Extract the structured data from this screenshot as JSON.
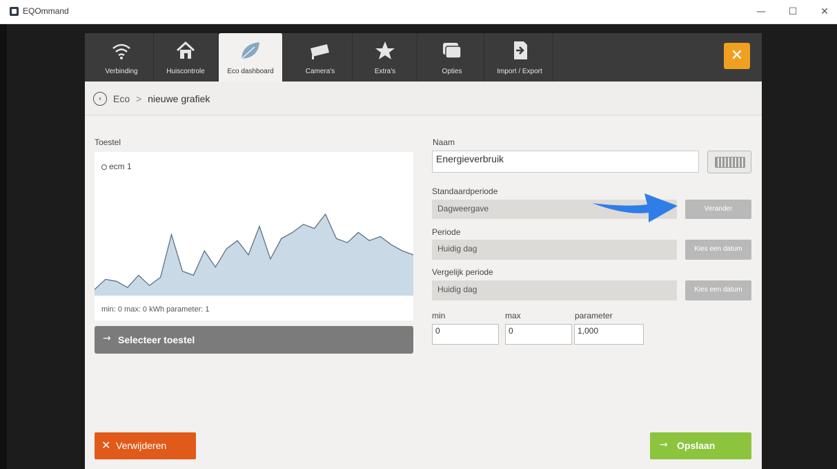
{
  "window": {
    "title": "EQOmmand",
    "min_glyph": "—",
    "max_glyph": "☐",
    "close_glyph": "✕"
  },
  "nav": {
    "tabs": [
      {
        "label": "Verbinding",
        "icon": "wifi-icon"
      },
      {
        "label": "Huiscontrole",
        "icon": "home-icon"
      },
      {
        "label": "Eco dashboard",
        "icon": "leaf-icon",
        "active": true
      },
      {
        "label": "Camera's",
        "icon": "camera-icon"
      },
      {
        "label": "Extra's",
        "icon": "star-icon"
      },
      {
        "label": "Opties",
        "icon": "options-icon"
      },
      {
        "label": "Import / Export",
        "icon": "import-export-icon"
      }
    ],
    "close_glyph": "✕"
  },
  "breadcrumb": {
    "back_glyph": "‹",
    "root": "Eco",
    "separator": ">",
    "current": "nieuwe grafiek"
  },
  "device": {
    "label": "Toestel",
    "name": "ecm 1",
    "minmax_text": "min: 0 max: 0 kWh parameter: 1",
    "select_arrow": "→",
    "select_label": "Selecteer toestel"
  },
  "chart_data": {
    "type": "area",
    "values": [
      3,
      8,
      7,
      4,
      10,
      5,
      9,
      30,
      12,
      10,
      22,
      14,
      23,
      27,
      20,
      34,
      18,
      28,
      31,
      35,
      33,
      40,
      28,
      26,
      31,
      27,
      29,
      25,
      22,
      20
    ],
    "color_fill": "#c9d9e6",
    "color_line": "#5b7187"
  },
  "form": {
    "name_label": "Naam",
    "name_value": "Energieverbruik",
    "std_period_label": "Standaardperiode",
    "std_period_value": "Dagweergave",
    "change_button": "Verander",
    "period_label": "Periode",
    "period_value": "Huidig dag",
    "pick_date_1": "Kies een datum",
    "compare_label": "Vergelijk periode",
    "compare_value": "Huidig dag",
    "pick_date_2": "Kies een datum",
    "min_label": "min",
    "max_label": "max",
    "param_label": "parameter",
    "min_value": "0",
    "max_value": "0",
    "param_value": "1,000"
  },
  "footer": {
    "delete_glyph": "✕",
    "delete_label": "Verwijderen",
    "save_arrow": "→",
    "save_label": "Opslaan"
  },
  "colors": {
    "accent_orange": "#f0a020",
    "delete_red": "#e05a1a",
    "save_green": "#8cc43e",
    "annotation_blue": "#2f7de8"
  }
}
